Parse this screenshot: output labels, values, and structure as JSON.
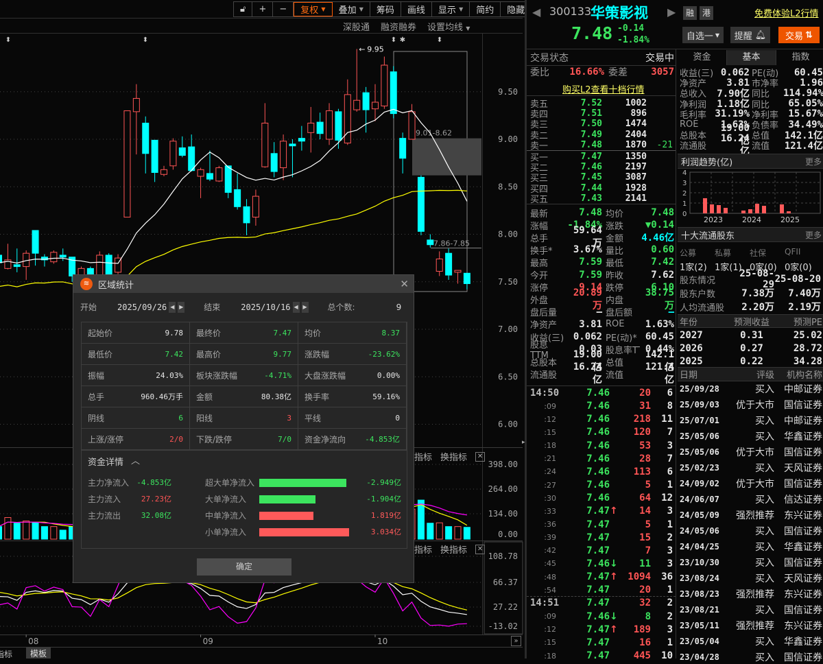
{
  "toolbar": {
    "buttons": [
      "复权",
      "叠加",
      "筹码",
      "画线",
      "显示",
      "简约",
      "隐藏"
    ],
    "sub": [
      "深股通",
      "融资融券",
      "设置均线"
    ]
  },
  "bottom_tabs": [
    "指标",
    "模板"
  ],
  "pane_tabs": {
    "indicator": "指标",
    "switch": "换指标"
  },
  "chart_data": {
    "type": "candlestick",
    "title": "300133 华策影视 日K",
    "price_ticks": [
      "9.50",
      "9.00",
      "8.50",
      "8.00",
      "7.50",
      "7.00",
      "6.50",
      "6.00"
    ],
    "price_tick_values": [
      9.5,
      9.0,
      8.5,
      8.0,
      7.5,
      7.0,
      6.5,
      6.0
    ],
    "volume_ticks": [
      "398.00",
      "264.00",
      "134.00",
      "0.00"
    ],
    "indicator_ticks": [
      "108.78",
      "66.37",
      "27.22",
      "-13.02"
    ],
    "x_ticks": [
      {
        "label": "08",
        "index": 3
      },
      {
        "label": "09",
        "index": 22
      },
      {
        "label": "10",
        "index": 41
      }
    ],
    "annotations": {
      "high_label": "9.95",
      "zone_label": "9.01-8.62",
      "zone": [
        8.62,
        9.01
      ],
      "level_label": "7.86-7.85",
      "level": 7.855,
      "selection_start_index": 43,
      "selection_end_index": 51
    },
    "candles": [
      [
        7.78,
        7.8,
        7.68,
        7.7,
        67
      ],
      [
        7.64,
        7.9,
        7.63,
        7.73,
        115
      ],
      [
        7.68,
        7.85,
        7.6,
        7.66,
        85
      ],
      [
        7.66,
        7.83,
        7.52,
        7.8,
        97
      ],
      [
        8.04,
        8.04,
        7.67,
        7.8,
        89
      ],
      [
        7.76,
        7.79,
        7.66,
        7.73,
        67
      ],
      [
        7.71,
        7.83,
        7.69,
        7.81,
        67
      ],
      [
        7.78,
        7.85,
        7.72,
        7.76,
        48
      ],
      [
        7.76,
        7.76,
        7.5,
        7.56,
        67
      ],
      [
        7.52,
        7.66,
        7.48,
        7.64,
        60
      ],
      [
        7.64,
        7.66,
        7.48,
        7.52,
        55
      ],
      [
        7.52,
        7.82,
        7.5,
        7.78,
        90
      ],
      [
        7.78,
        7.8,
        7.55,
        7.58,
        80
      ],
      [
        7.6,
        7.79,
        7.58,
        7.75,
        70
      ],
      [
        8.18,
        9.3,
        8.18,
        9.3,
        260
      ],
      [
        9.29,
        9.58,
        8.84,
        9.43,
        390
      ],
      [
        9.17,
        9.24,
        8.64,
        8.85,
        280
      ],
      [
        8.99,
        8.99,
        8.55,
        8.65,
        200
      ],
      [
        8.63,
        8.72,
        8.61,
        8.68,
        120
      ],
      [
        8.72,
        9.01,
        8.68,
        8.98,
        170
      ],
      [
        8.91,
        9.03,
        8.81,
        8.83,
        130
      ],
      [
        8.92,
        9.05,
        8.66,
        8.67,
        150
      ],
      [
        8.61,
        8.7,
        8.38,
        8.68,
        110
      ],
      [
        8.64,
        8.88,
        8.56,
        8.58,
        120
      ],
      [
        8.56,
        8.72,
        8.55,
        8.7,
        100
      ],
      [
        8.72,
        8.72,
        8.38,
        8.44,
        130
      ],
      [
        8.47,
        8.64,
        8.26,
        8.29,
        120
      ],
      [
        8.29,
        8.37,
        7.99,
        8.12,
        140
      ],
      [
        8.18,
        8.47,
        8.09,
        8.4,
        150
      ],
      [
        8.71,
        9.38,
        8.7,
        9.17,
        260
      ],
      [
        8.85,
        8.97,
        8.6,
        8.66,
        180
      ],
      [
        8.7,
        9.05,
        8.57,
        8.98,
        170
      ],
      [
        8.95,
        9.0,
        8.6,
        8.93,
        140
      ],
      [
        9.01,
        9.14,
        8.88,
        8.98,
        120
      ],
      [
        9.07,
        9.34,
        8.86,
        9.17,
        160
      ],
      [
        9.18,
        9.28,
        9.0,
        9.06,
        130
      ],
      [
        9.0,
        9.38,
        8.94,
        9.3,
        170
      ],
      [
        9.29,
        9.32,
        8.9,
        8.99,
        150
      ],
      [
        8.96,
        9.63,
        8.94,
        9.47,
        230
      ],
      [
        9.31,
        9.95,
        9.29,
        9.41,
        260
      ],
      [
        9.49,
        9.55,
        9.07,
        9.31,
        170
      ],
      [
        9.32,
        9.58,
        9.19,
        9.39,
        140
      ],
      [
        9.35,
        9.87,
        9.32,
        9.78,
        210
      ],
      [
        9.71,
        9.77,
        9.22,
        9.27,
        190
      ],
      [
        9.01,
        9.07,
        8.64,
        8.8,
        150
      ],
      [
        9.0,
        9.37,
        9.0,
        9.29,
        160
      ],
      [
        8.6,
        8.62,
        7.99,
        8.03,
        208
      ],
      [
        7.94,
        8.0,
        7.86,
        7.89,
        85
      ],
      [
        7.61,
        7.82,
        7.56,
        7.74,
        87
      ],
      [
        7.8,
        7.85,
        7.52,
        7.57,
        67
      ],
      [
        7.6,
        7.62,
        7.48,
        7.62,
        67
      ],
      [
        7.59,
        7.59,
        7.42,
        7.48,
        63
      ]
    ],
    "candle_fields": [
      "open",
      "high",
      "low",
      "close",
      "volume"
    ],
    "colors": {
      "up": "#ff5555",
      "down": "#00ffff",
      "ma_short": "#ffffff",
      "ma_long": "#ffff00",
      "j_line": "#ff00ff"
    }
  },
  "dialog": {
    "title": "区域统计",
    "start_label": "开始",
    "start_date": "2025/09/26",
    "end_label": "结束",
    "end_date": "2025/10/16",
    "count_label": "总个数:",
    "count": "9",
    "stats": [
      {
        "k": "起始价",
        "v": "9.78",
        "c": "wht"
      },
      {
        "k": "最终价",
        "v": "7.47",
        "c": "grn"
      },
      {
        "k": "均价",
        "v": "8.37",
        "c": "grn"
      },
      {
        "k": "最低价",
        "v": "7.42",
        "c": "grn"
      },
      {
        "k": "最高价",
        "v": "9.77",
        "c": "grn"
      },
      {
        "k": "涨跌幅",
        "v": "-23.62%",
        "c": "grn"
      },
      {
        "k": "振幅",
        "v": "24.03%",
        "c": "wht"
      },
      {
        "k": "板块涨跌幅",
        "v": "-4.71%",
        "c": "grn"
      },
      {
        "k": "大盘涨跌幅",
        "v": "0.00%",
        "c": "wht"
      },
      {
        "k": "总手",
        "v": "960.46万手",
        "c": "wht"
      },
      {
        "k": "金额",
        "v": "80.38亿",
        "c": "wht"
      },
      {
        "k": "换手率",
        "v": "59.16%",
        "c": "wht"
      },
      {
        "k": "阴线",
        "v": "6",
        "c": "grn"
      },
      {
        "k": "阳线",
        "v": "3",
        "c": "red"
      },
      {
        "k": "平线",
        "v": "0",
        "c": "wht"
      },
      {
        "k": "上涨/涨停",
        "v": "2/0",
        "c": "red"
      },
      {
        "k": "下跌/跌停",
        "v": "7/0",
        "c": "grn"
      },
      {
        "k": "资金净流向",
        "v": "-4.853亿",
        "c": "grn"
      }
    ],
    "fund_title": "资金详情",
    "fund_left": [
      {
        "k": "主力净流入",
        "v": "-4.853亿",
        "c": "grn"
      },
      {
        "k": "主力流入",
        "v": "27.23亿",
        "c": "red"
      },
      {
        "k": "主力流出",
        "v": "32.08亿",
        "c": "grn"
      }
    ],
    "fund_bars": [
      {
        "k": "超大单净流入",
        "v": "-2.949亿",
        "n": -2.949
      },
      {
        "k": "大单净流入",
        "v": "-1.904亿",
        "n": -1.904
      },
      {
        "k": "中单净流入",
        "v": "1.819亿",
        "n": 1.819
      },
      {
        "k": "小单净流入",
        "v": "3.034亿",
        "n": 3.034
      }
    ],
    "ok": "确定"
  },
  "quote": {
    "code": "300133",
    "name": "华策影视",
    "badges": [
      "融",
      "港"
    ],
    "l2_link": "免费体验L2行情",
    "price": "7.48",
    "change": "-0.14",
    "change_pct": "-1.84%",
    "watch_btn": "自选一",
    "alert_btn": "提醒",
    "trade_btn": "交易",
    "status_label": "交易状态",
    "status": "交易中",
    "wb_label": "委比",
    "wb": "16.66%",
    "wc_label": "委差",
    "wc": "3057",
    "buy_l2": "购买L2查看十档行情",
    "asks": [
      {
        "k": "卖五",
        "p": "7.52",
        "v": "1002"
      },
      {
        "k": "卖四",
        "p": "7.51",
        "v": "896"
      },
      {
        "k": "卖三",
        "p": "7.50",
        "v": "1474"
      },
      {
        "k": "卖二",
        "p": "7.49",
        "v": "2404"
      },
      {
        "k": "卖一",
        "p": "7.48",
        "v": "1870",
        "d": "-21"
      }
    ],
    "bids": [
      {
        "k": "买一",
        "p": "7.47",
        "v": "1350"
      },
      {
        "k": "买二",
        "p": "7.46",
        "v": "2197"
      },
      {
        "k": "买三",
        "p": "7.45",
        "v": "3087"
      },
      {
        "k": "买四",
        "p": "7.44",
        "v": "1928"
      },
      {
        "k": "买五",
        "p": "7.43",
        "v": "2141"
      }
    ],
    "stats": [
      {
        "k1": "最新",
        "v1": "7.48",
        "c1": "grn",
        "k2": "均价",
        "v2": "7.48",
        "c2": "grn"
      },
      {
        "k1": "涨幅",
        "v1": "-1.84%",
        "c1": "grn",
        "k2": "涨跌",
        "v2": "▼0.14",
        "c2": "grn"
      },
      {
        "k1": "总手",
        "v1": "59.64万",
        "c1": "wht",
        "k2": "金额",
        "v2": "4.46亿",
        "c2": "cyan"
      },
      {
        "k1": "换手*",
        "v1": "3.67%",
        "c1": "wht",
        "k2": "量比",
        "v2": "0.60",
        "c2": "grn"
      },
      {
        "k1": "最高",
        "v1": "7.59",
        "c1": "grn",
        "k2": "最低",
        "v2": "7.42",
        "c2": "grn"
      },
      {
        "k1": "今开",
        "v1": "7.59",
        "c1": "grn",
        "k2": "昨收",
        "v2": "7.62",
        "c2": "wht"
      },
      {
        "k1": "涨停",
        "v1": "9.14",
        "c1": "red",
        "k2": "跌停",
        "v2": "6.10",
        "c2": "grn"
      },
      {
        "k1": "外盘",
        "v1": "20.89万",
        "c1": "red",
        "k2": "内盘",
        "v2": "38.75万",
        "c2": "grn"
      },
      {
        "k1": "盘后量",
        "v1": "—",
        "c1": "wht",
        "k2": "盘后额",
        "v2": "—",
        "c2": "cyan"
      },
      {
        "k1": "净资产",
        "v1": "3.81",
        "c1": "wht",
        "k2": "ROE",
        "v2": "1.63%",
        "c2": "wht"
      },
      {
        "k1": "收益(三)",
        "v1": "0.062",
        "c1": "wht",
        "k2": "PE(动)*",
        "v2": "60.45",
        "c2": "wht"
      },
      {
        "k1": "股息TTM",
        "v1": "0.03",
        "c1": "wht",
        "k2": "股息率TTM",
        "v2": "0.44%",
        "c2": "wht"
      },
      {
        "k1": "总股本",
        "v1": "19.00亿",
        "c1": "wht",
        "k2": "总值",
        "v2": "142.1亿",
        "c2": "wht"
      },
      {
        "k1": "流通股",
        "v1": "16.24亿",
        "c1": "wht",
        "k2": "流值",
        "v2": "121.4亿",
        "c2": "wht"
      }
    ],
    "trades": [
      {
        "t": "14:50",
        "p": "7.46",
        "a": "",
        "v": "20",
        "vc": "red",
        "n": "6"
      },
      {
        "t": ":09",
        "p": "7.46",
        "a": "",
        "v": "31",
        "vc": "red",
        "n": "8"
      },
      {
        "t": ":12",
        "p": "7.46",
        "a": "",
        "v": "218",
        "vc": "red",
        "n": "11"
      },
      {
        "t": ":15",
        "p": "7.46",
        "a": "",
        "v": "120",
        "vc": "red",
        "n": "7"
      },
      {
        "t": ":18",
        "p": "7.46",
        "a": "",
        "v": "53",
        "vc": "red",
        "n": "3"
      },
      {
        "t": ":21",
        "p": "7.46",
        "a": "",
        "v": "28",
        "vc": "red",
        "n": "7"
      },
      {
        "t": ":24",
        "p": "7.46",
        "a": "",
        "v": "113",
        "vc": "red",
        "n": "6"
      },
      {
        "t": ":27",
        "p": "7.46",
        "a": "",
        "v": "5",
        "vc": "red",
        "n": "1"
      },
      {
        "t": ":30",
        "p": "7.46",
        "a": "",
        "v": "64",
        "vc": "red",
        "n": "12"
      },
      {
        "t": ":33",
        "p": "7.47",
        "a": "↑",
        "v": "14",
        "vc": "red",
        "n": "3"
      },
      {
        "t": ":36",
        "p": "7.47",
        "a": "",
        "v": "5",
        "vc": "red",
        "n": "1"
      },
      {
        "t": ":39",
        "p": "7.47",
        "a": "",
        "v": "15",
        "vc": "red",
        "n": "2"
      },
      {
        "t": ":42",
        "p": "7.47",
        "a": "",
        "v": "7",
        "vc": "red",
        "n": "3"
      },
      {
        "t": ":45",
        "p": "7.46",
        "a": "↓",
        "v": "11",
        "vc": "grn",
        "n": "3"
      },
      {
        "t": ":48",
        "p": "7.47",
        "a": "↑",
        "v": "1094",
        "vc": "red",
        "n": "36"
      },
      {
        "t": ":54",
        "p": "7.47",
        "a": "",
        "v": "20",
        "vc": "red",
        "n": "1"
      },
      {
        "t": "14:51",
        "p": "7.47",
        "a": "",
        "v": "32",
        "vc": "red",
        "n": "2"
      },
      {
        "t": ":09",
        "p": "7.46",
        "a": "↓",
        "v": "8",
        "vc": "grn",
        "n": "2"
      },
      {
        "t": ":12",
        "p": "7.47",
        "a": "↑",
        "v": "189",
        "vc": "red",
        "n": "3"
      },
      {
        "t": ":15",
        "p": "7.47",
        "a": "",
        "v": "16",
        "vc": "red",
        "n": "1"
      },
      {
        "t": ":18",
        "p": "7.47",
        "a": "",
        "v": "445",
        "vc": "red",
        "n": "10"
      }
    ],
    "tabs": [
      "资金",
      "基本",
      "指数"
    ],
    "fin": [
      {
        "k1": "收益(三)",
        "v1": "0.062",
        "k2": "PE(动)",
        "v2": "60.45"
      },
      {
        "k1": "净资产",
        "v1": "3.81",
        "k2": "市净率",
        "v2": "1.96"
      },
      {
        "k1": "总收入",
        "v1": "7.90亿",
        "k2": "同比",
        "v2": "114.94%"
      },
      {
        "k1": "净利润",
        "v1": "1.18亿",
        "k2": "同比",
        "v2": "65.05%"
      },
      {
        "k1": "毛利率",
        "v1": "31.19%",
        "k2": "净利率",
        "v2": "15.67%"
      },
      {
        "k1": "ROE",
        "v1": "1.63%",
        "k2": "负债率",
        "v2": "34.49%"
      },
      {
        "k1": "总股本",
        "v1": "19.00亿",
        "k2": "总值",
        "v2": "142.1亿"
      },
      {
        "k1": "流通股",
        "v1": "16.24亿",
        "k2": "流值",
        "v2": "121.4亿"
      }
    ],
    "profit_title": "利润趋势(亿)",
    "more": "更多",
    "profit": {
      "y_ticks": [
        "4",
        "3",
        "2",
        "1",
        "0"
      ],
      "years": [
        "2023",
        "2024",
        "2025"
      ],
      "values": [
        [
          1.47,
          0.87,
          0.8,
          0.53
        ],
        [
          0.27,
          0.4,
          0.93,
          0.73
        ],
        [
          0.87,
          0.2
        ]
      ]
    },
    "holders_title": "十大流通股东",
    "holder_types": [
      "公募",
      "私募",
      "社保",
      "QFII"
    ],
    "holder_counts": [
      "1家(2)",
      "1家(1)",
      "0家(0)",
      "0家(0)"
    ],
    "holder_rows": [
      {
        "k": "股东情况",
        "a": "25-08-29",
        "b": "25-08-20"
      },
      {
        "k": "股东户数",
        "a": "7.38万",
        "b": "7.40万"
      },
      {
        "k": "人均流通股",
        "a": "2.20万",
        "b": "2.19万"
      }
    ],
    "forecast_hdr": [
      "年份",
      "预测收益",
      "预测PE"
    ],
    "forecast": [
      [
        "2027",
        "0.31",
        "25.02"
      ],
      [
        "2026",
        "0.27",
        "28.72"
      ],
      [
        "2025",
        "0.22",
        "34.28"
      ]
    ],
    "rating_hdr": [
      "日期",
      "评级",
      "机构名称"
    ],
    "ratings": [
      [
        "25/09/28",
        "买入",
        "中邮证券"
      ],
      [
        "25/09/03",
        "优于大市",
        "国信证券"
      ],
      [
        "25/07/01",
        "买入",
        "中邮证券"
      ],
      [
        "25/05/06",
        "买入",
        "华鑫证券"
      ],
      [
        "25/05/06",
        "优于大市",
        "国信证券"
      ],
      [
        "25/02/23",
        "买入",
        "天风证券"
      ],
      [
        "24/09/02",
        "优于大市",
        "国信证券"
      ],
      [
        "24/06/07",
        "买入",
        "信达证券"
      ],
      [
        "24/05/09",
        "强烈推荐",
        "东兴证券"
      ],
      [
        "24/05/06",
        "买入",
        "国信证券"
      ],
      [
        "24/04/25",
        "买入",
        "华鑫证券"
      ],
      [
        "23/10/30",
        "买入",
        "国信证券"
      ],
      [
        "23/08/24",
        "买入",
        "天风证券"
      ],
      [
        "23/08/23",
        "强烈推荐",
        "东兴证券"
      ],
      [
        "23/08/21",
        "买入",
        "国信证券"
      ],
      [
        "23/05/11",
        "强烈推荐",
        "东兴证券"
      ],
      [
        "23/05/04",
        "买入",
        "华鑫证券"
      ],
      [
        "23/04/28",
        "买入",
        "国信证券"
      ]
    ]
  }
}
